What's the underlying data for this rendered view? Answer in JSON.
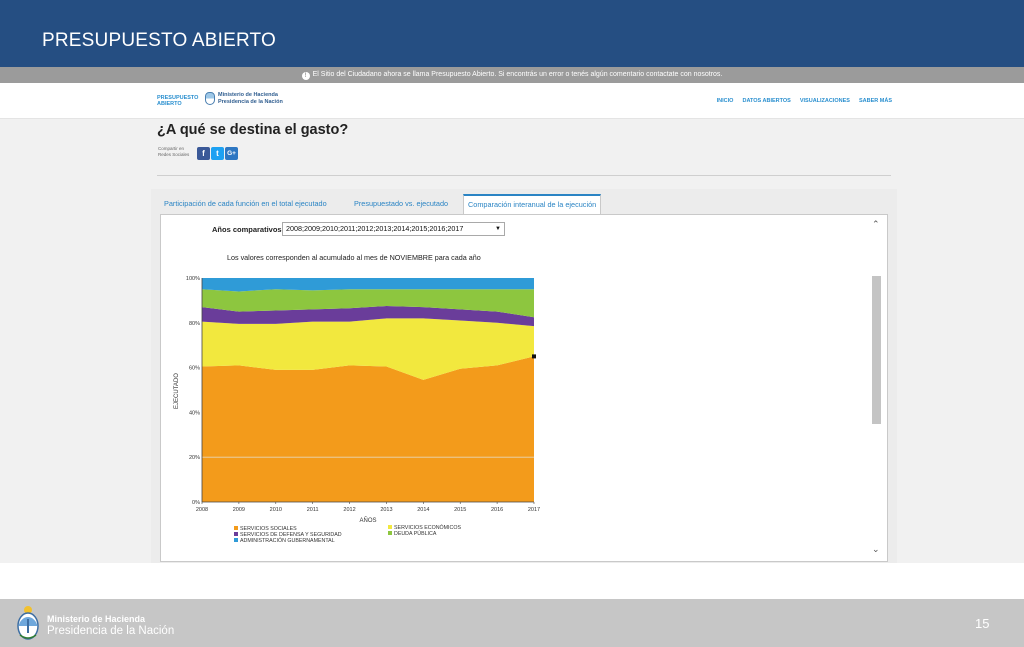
{
  "slide": {
    "title": "PRESUPUESTO ABIERTO",
    "page_number": "15"
  },
  "notice": {
    "icon": "info-icon",
    "text": "El Sitio del Ciudadano ahora se llama Presupuesto Abierto. Si encontrás un error o tenés algún comentario contactate con nosotros."
  },
  "site": {
    "logo_line1": "PRESUPUESTO",
    "logo_line2": "ABIERTO",
    "ministry_line1": "Ministerio de Hacienda",
    "ministry_line2": "Presidencia de la Nación",
    "nav": [
      "INICIO",
      "DATOS ABIERTOS",
      "VISUALIZACIONES",
      "SABER MÁS"
    ]
  },
  "page": {
    "heading": "¿A qué se destina el gasto?",
    "share_label": "Compartir en Redes Sociales",
    "social_icons": [
      "facebook-icon",
      "twitter-icon",
      "google-plus-icon"
    ]
  },
  "tabs": [
    {
      "label": "Participación de cada función en el total ejecutado",
      "active": false
    },
    {
      "label": "Presupuestado vs. ejecutado",
      "active": false
    },
    {
      "label": "Comparación interanual de la ejecución",
      "active": true
    }
  ],
  "controls": {
    "years_label": "Años comparativos:",
    "years_value": "2008;2009;2010;2011;2012;2013;2014;2015;2016;2017"
  },
  "chart_note": "Los valores corresponden al acumulado al mes de NOVIEMBRE para cada año",
  "chart_data": {
    "type": "area",
    "stacked": true,
    "xlabel": "AÑOS",
    "ylabel": "EJECUTADO",
    "x": [
      "2008",
      "2009",
      "2010",
      "2011",
      "2012",
      "2013",
      "2014",
      "2015",
      "2016",
      "2017"
    ],
    "y_ticks": [
      "0%",
      "20%",
      "40%",
      "60%",
      "80%",
      "100%"
    ],
    "ylim": [
      0,
      100
    ],
    "series": [
      {
        "name": "SERVICIOS SOCIALES",
        "color": "#f39b1b",
        "values": [
          60.5,
          61,
          59,
          59,
          61,
          60.5,
          54.5,
          59.5,
          61,
          65
        ]
      },
      {
        "name": "SERVICIOS ECONÓMICOS",
        "color": "#f2e83e",
        "values": [
          20,
          18.5,
          20.5,
          21.5,
          19.5,
          21.5,
          27.5,
          21.5,
          19,
          13.5
        ]
      },
      {
        "name": "SERVICIOS DE DEFENSA Y SEGURIDAD",
        "color": "#6a3d9a",
        "values": [
          6.5,
          5.5,
          6,
          5.5,
          6,
          5.5,
          5,
          5,
          5,
          4
        ]
      },
      {
        "name": "DEUDA PÚBLICA",
        "color": "#8dc63f",
        "values": [
          8,
          9,
          9.5,
          8.5,
          8.5,
          7.5,
          8,
          9,
          10,
          12.5
        ]
      },
      {
        "name": "ADMINISTRACIÓN GUBERNAMENTAL",
        "color": "#2f9bd7",
        "values": [
          5,
          6,
          5,
          5.5,
          5,
          5,
          5,
          5,
          5,
          5
        ]
      }
    ],
    "legend_position": "bottom-left",
    "grid": true
  },
  "footer": {
    "ministry": "Ministerio de Hacienda",
    "presidency": "Presidencia de la Nación"
  }
}
